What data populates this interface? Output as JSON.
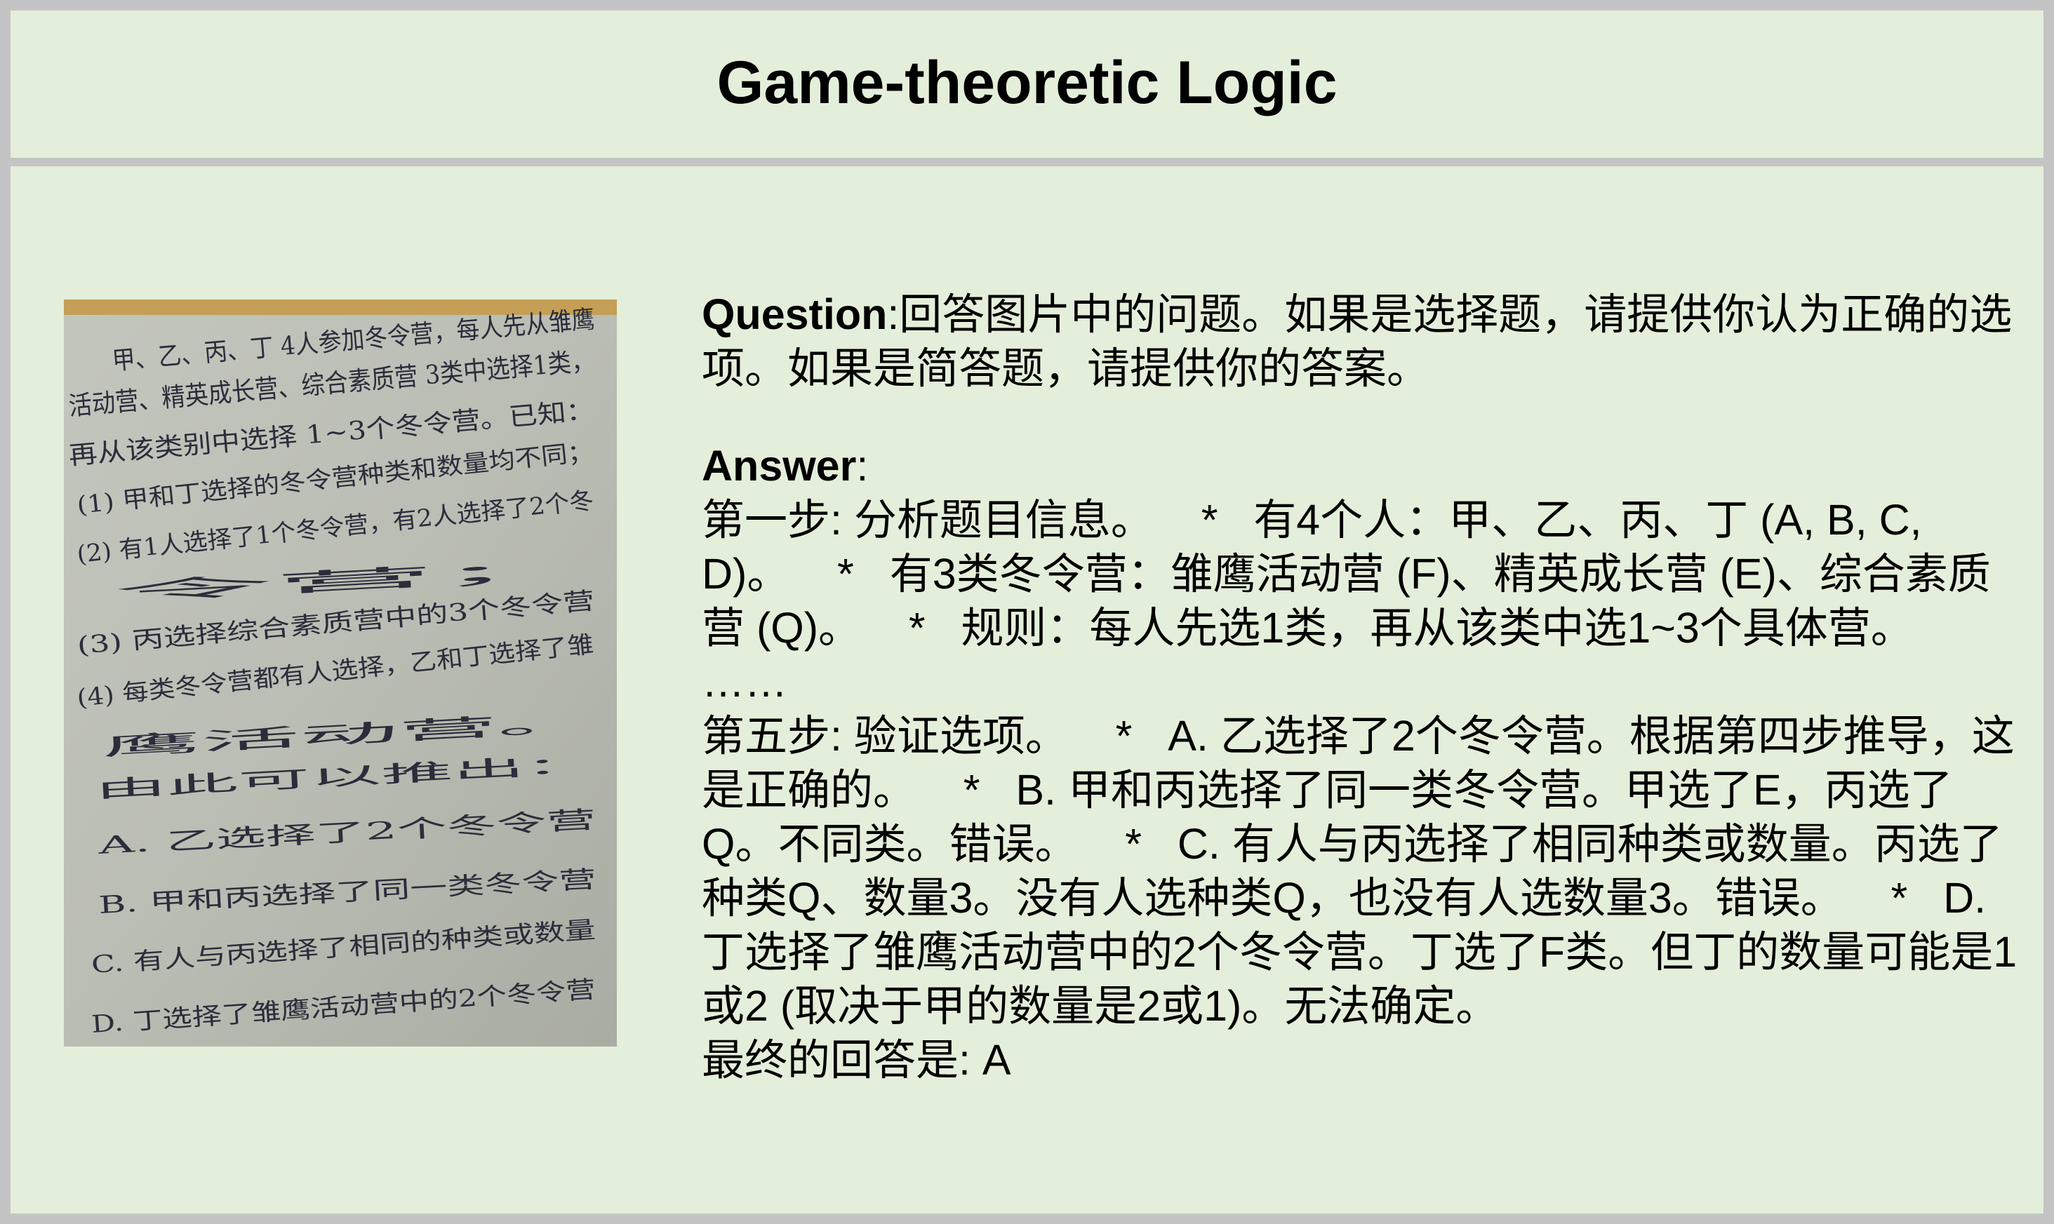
{
  "header": {
    "title": "Game-theoretic Logic"
  },
  "photo": {
    "lines": [
      "甲、乙、丙、丁 4人参加冬令营，每人先从雏鹰",
      "活动营、精英成长营、综合素质营 3类中选择1类，",
      "再从该类别中选择 1~3个冬令营。已知：",
      "(1) 甲和丁选择的冬令营种类和数量均不同；",
      "(2) 有1人选择了1个冬令营，有2人选择了2个冬",
      "令营；",
      "(3) 丙选择综合素质营中的3个冬令营",
      "(4) 每类冬令营都有人选择，乙和丁选择了雏",
      "鹰活动营。",
      "由此可以推出：",
      "A. 乙选择了2个冬令营",
      "B. 甲和丙选择了同一类冬令营",
      "C. 有人与丙选择了相同的种类或数量",
      "D. 丁选择了雏鹰活动营中的2个冬令营"
    ]
  },
  "question": {
    "label": "Question",
    "sep": ":",
    "text": "回答图片中的问题。如果是选择题，请提供你认为正确的选项。如果是简答题，请提供你的答案。"
  },
  "answer": {
    "label": "Answer",
    "sep": ":",
    "step1": "第一步: 分析题目信息。    *   有4个人：甲、乙、丙、丁 (A, B, C, D)。    *   有3类冬令营：雏鹰活动营 (F)、精英成长营 (E)、综合素质营 (Q)。    *   规则：每人先选1类，再从该类中选1~3个具体营。",
    "ellipsis": "……",
    "step5": "第五步: 验证选项。    *   A. 乙选择了2个冬令营。根据第四步推导，这是正确的。    *   B. 甲和丙选择了同一类冬令营。甲选了E，丙选了Q。不同类。错误。    *   C. 有人与丙选择了相同种类或数量。丙选了种类Q、数量3。没有人选种类Q，也没有人选数量3。错误。    *   D. 丁选择了雏鹰活动营中的2个冬令营。丁选了F类。但丁的数量可能是1或2 (取决于甲的数量是2或1)。无法确定。",
    "final": "最终的回答是: A"
  }
}
